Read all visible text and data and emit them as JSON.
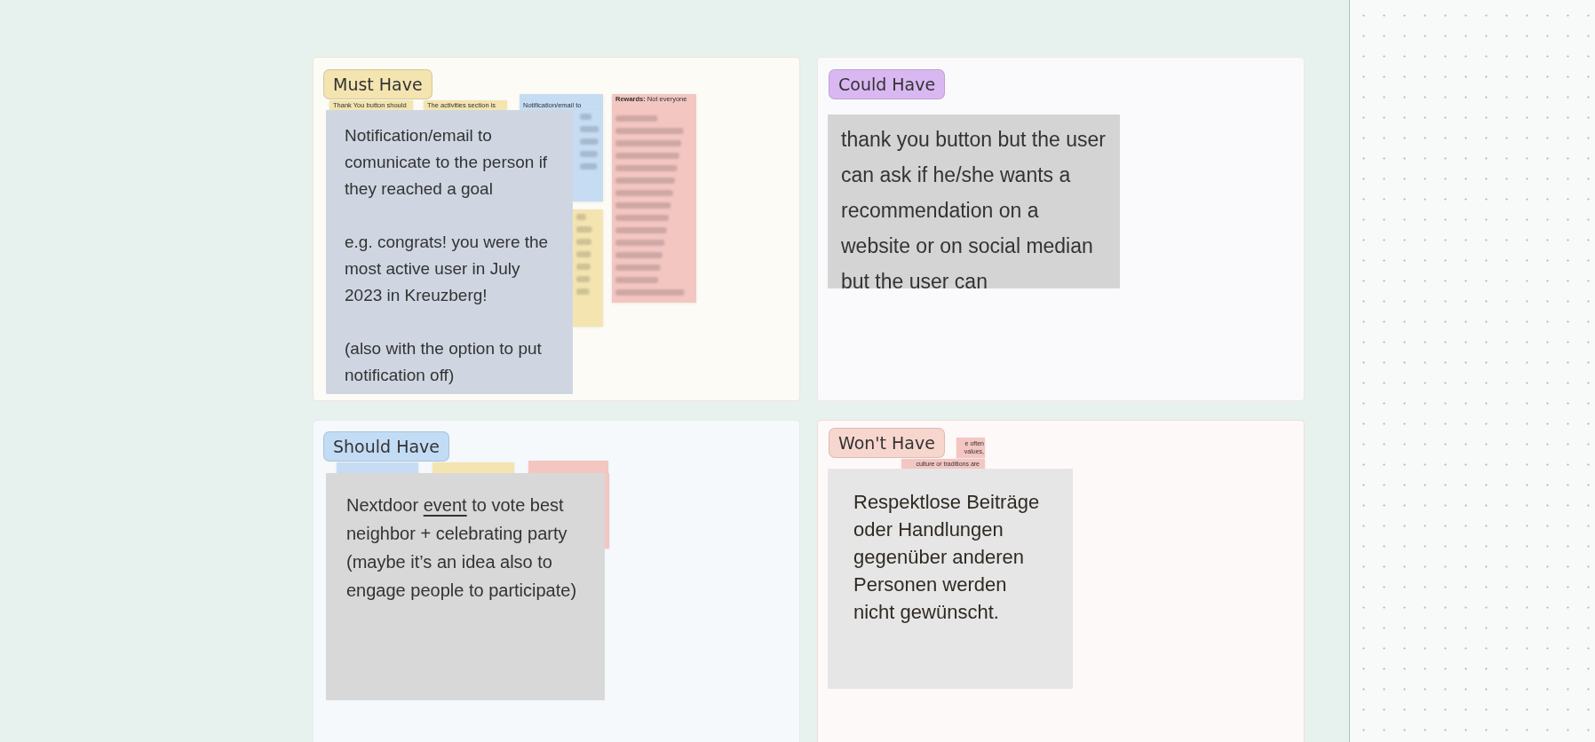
{
  "board": {
    "quadrants": [
      {
        "kind": "must",
        "label": "Must Have",
        "color": "#f3e4b0",
        "background_notes": [
          {
            "color": "#f3e4b0",
            "text": "Thank You button should"
          },
          {
            "color": "#f3e4b0",
            "text": "The activities section is"
          },
          {
            "color": "#c5dcf3",
            "text": "Notification/email to"
          },
          {
            "color": "#f3c6c2",
            "text": "**Rewards:** Not everyone"
          },
          {
            "color": "#f3e4b0"
          }
        ],
        "note": {
          "segments": [
            {
              "text": "Notification/email to comunicate to the person if they reached a goal\n\ne.g. congrats! you were the most active user in July 2023 in Kreuzberg!\n\n(also with the option to put notification off)"
            }
          ]
        }
      },
      {
        "kind": "could",
        "label": "Could Have",
        "color": "#d9b8f2",
        "note": {
          "segments": [
            {
              "text": "thank you button but the user can ask if he/she wants a recommendation on a website or on social median but the user can"
            }
          ]
        }
      },
      {
        "kind": "should",
        "label": "Should Have",
        "color": "#c3dcf5",
        "background_notes": [
          {
            "color": "#c5dcf3"
          },
          {
            "color": "#f3e4b0"
          },
          {
            "color": "#f3c6c2"
          }
        ],
        "note": {
          "segments": [
            {
              "text": "Nextdoor "
            },
            {
              "text": "event",
              "underline": true
            },
            {
              "text": " to vote best neighbor + celebrating party\n(maybe it’s an idea also to engage people to participate)"
            }
          ]
        }
      },
      {
        "kind": "wont",
        "label": "Won't Have",
        "color": "#f7d6ce",
        "background_notes": [
          {
            "color": "#f3c6c2",
            "lines": [
              "e often",
              "values,",
              "culture or traditions are"
            ]
          }
        ],
        "note": {
          "segments": [
            {
              "text": "Respektlose Beiträge oder Handlungen gegenüber anderen Personen werden nicht gewünscht."
            }
          ]
        }
      }
    ]
  }
}
